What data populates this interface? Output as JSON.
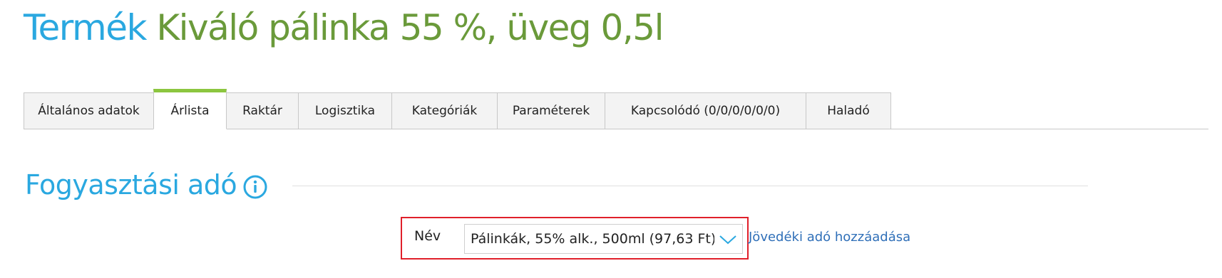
{
  "header": {
    "label": "Termék",
    "product_name": "Kiváló pálinka 55 %, üveg 0,5l"
  },
  "tabs": [
    {
      "label": "Általános adatok"
    },
    {
      "label": "Árlista",
      "active": true
    },
    {
      "label": "Raktár"
    },
    {
      "label": "Logisztika"
    },
    {
      "label": "Kategóriák"
    },
    {
      "label": "Paraméterek"
    },
    {
      "label": "Kapcsolódó (0/0/0/0/0/0)"
    },
    {
      "label": "Haladó"
    }
  ],
  "section": {
    "title": "Fogyasztási adó",
    "info_icon": "info-circle-icon"
  },
  "tax_field": {
    "label": "Név",
    "selected_value": "Pálinkák, 55% alk., 500ml (97,63 Ft)",
    "add_link": "Jövedéki adó hozzáadása"
  },
  "colors": {
    "accent_blue": "#2aa8e0",
    "product_green": "#6a9a3a",
    "active_tab_green": "#8cc63f",
    "highlight_red": "#e0202a",
    "link_blue": "#2f6fb8"
  }
}
